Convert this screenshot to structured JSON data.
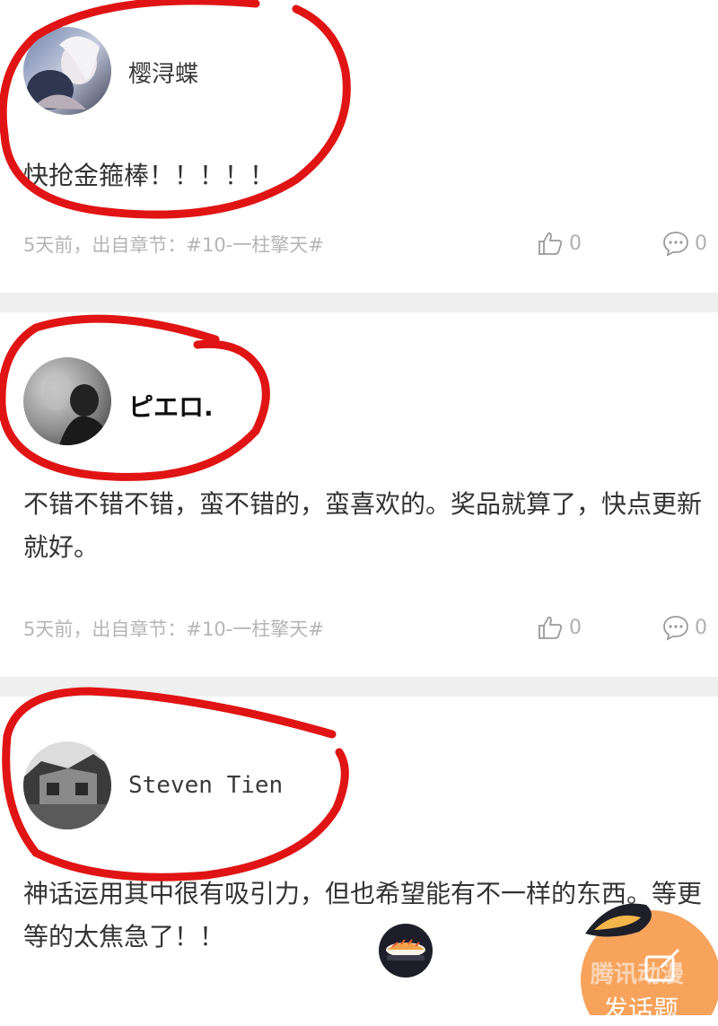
{
  "comments": [
    {
      "username": "樱浔蝶",
      "text": "快抢金箍棒！！！！！",
      "meta": "5天前，出自章节：#10-一柱擎天#",
      "likes": "0",
      "replies": "0"
    },
    {
      "username": "ピエロ.",
      "text": "不错不错不错，蛮不错的，蛮喜欢的。奖品就算了，快点更新就好。",
      "meta": "5天前，出自章节：#10-一柱擎天#",
      "likes": "0",
      "replies": "0"
    },
    {
      "username": "Steven Tien",
      "text": "神话运用其中很有吸引力，但也希望能有不一样的东西。等更等的太焦急了！！"
    }
  ],
  "fab": {
    "label": "发话题",
    "watermark": "腾讯动漫"
  },
  "colors": {
    "annotation_red": "#e01414",
    "separator": "#efefef",
    "meta_text": "#b5b5b5",
    "fab_orange": "#f7a35c"
  },
  "icons": {
    "like": "thumb-up-icon",
    "reply": "comment-bubble-icon"
  }
}
